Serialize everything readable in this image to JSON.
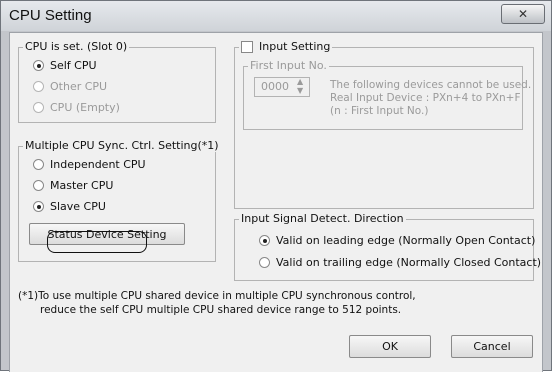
{
  "window": {
    "title": "CPU Setting",
    "close_glyph": "✕"
  },
  "cpu_is_set": {
    "legend": "CPU is set. (Slot 0)",
    "options": [
      {
        "label": "Self CPU",
        "selected": true,
        "enabled": true
      },
      {
        "label": "Other CPU",
        "selected": false,
        "enabled": false
      },
      {
        "label": "CPU (Empty)",
        "selected": false,
        "enabled": false
      }
    ]
  },
  "sync_setting": {
    "legend": "Multiple CPU Sync. Ctrl. Setting(*1)",
    "options": [
      {
        "label": "Independent CPU",
        "selected": false
      },
      {
        "label": "Master CPU",
        "selected": false
      },
      {
        "label": "Slave CPU",
        "selected": true
      }
    ],
    "status_button": "Status Device Setting"
  },
  "input_setting": {
    "label": "Input Setting",
    "checked": false,
    "first_input_legend": "First Input No.",
    "first_input_value": "0000",
    "note_lines": [
      "The following devices cannot be used.",
      "Real Input Device   : PXn+4 to PXn+F",
      "(n : First Input No.)"
    ]
  },
  "detect_direction": {
    "legend": "Input Signal Detect. Direction",
    "options": [
      {
        "label": "Valid on leading edge (Normally Open Contact)",
        "selected": true
      },
      {
        "label": "Valid on trailing edge (Normally Closed Contact)",
        "selected": false
      }
    ]
  },
  "footnote": {
    "line1": "(*1)To use multiple CPU shared device in multiple CPU synchronous control,",
    "line2": "reduce the self CPU multiple CPU shared device range to 512 points."
  },
  "buttons": {
    "ok": "OK",
    "cancel": "Cancel"
  }
}
